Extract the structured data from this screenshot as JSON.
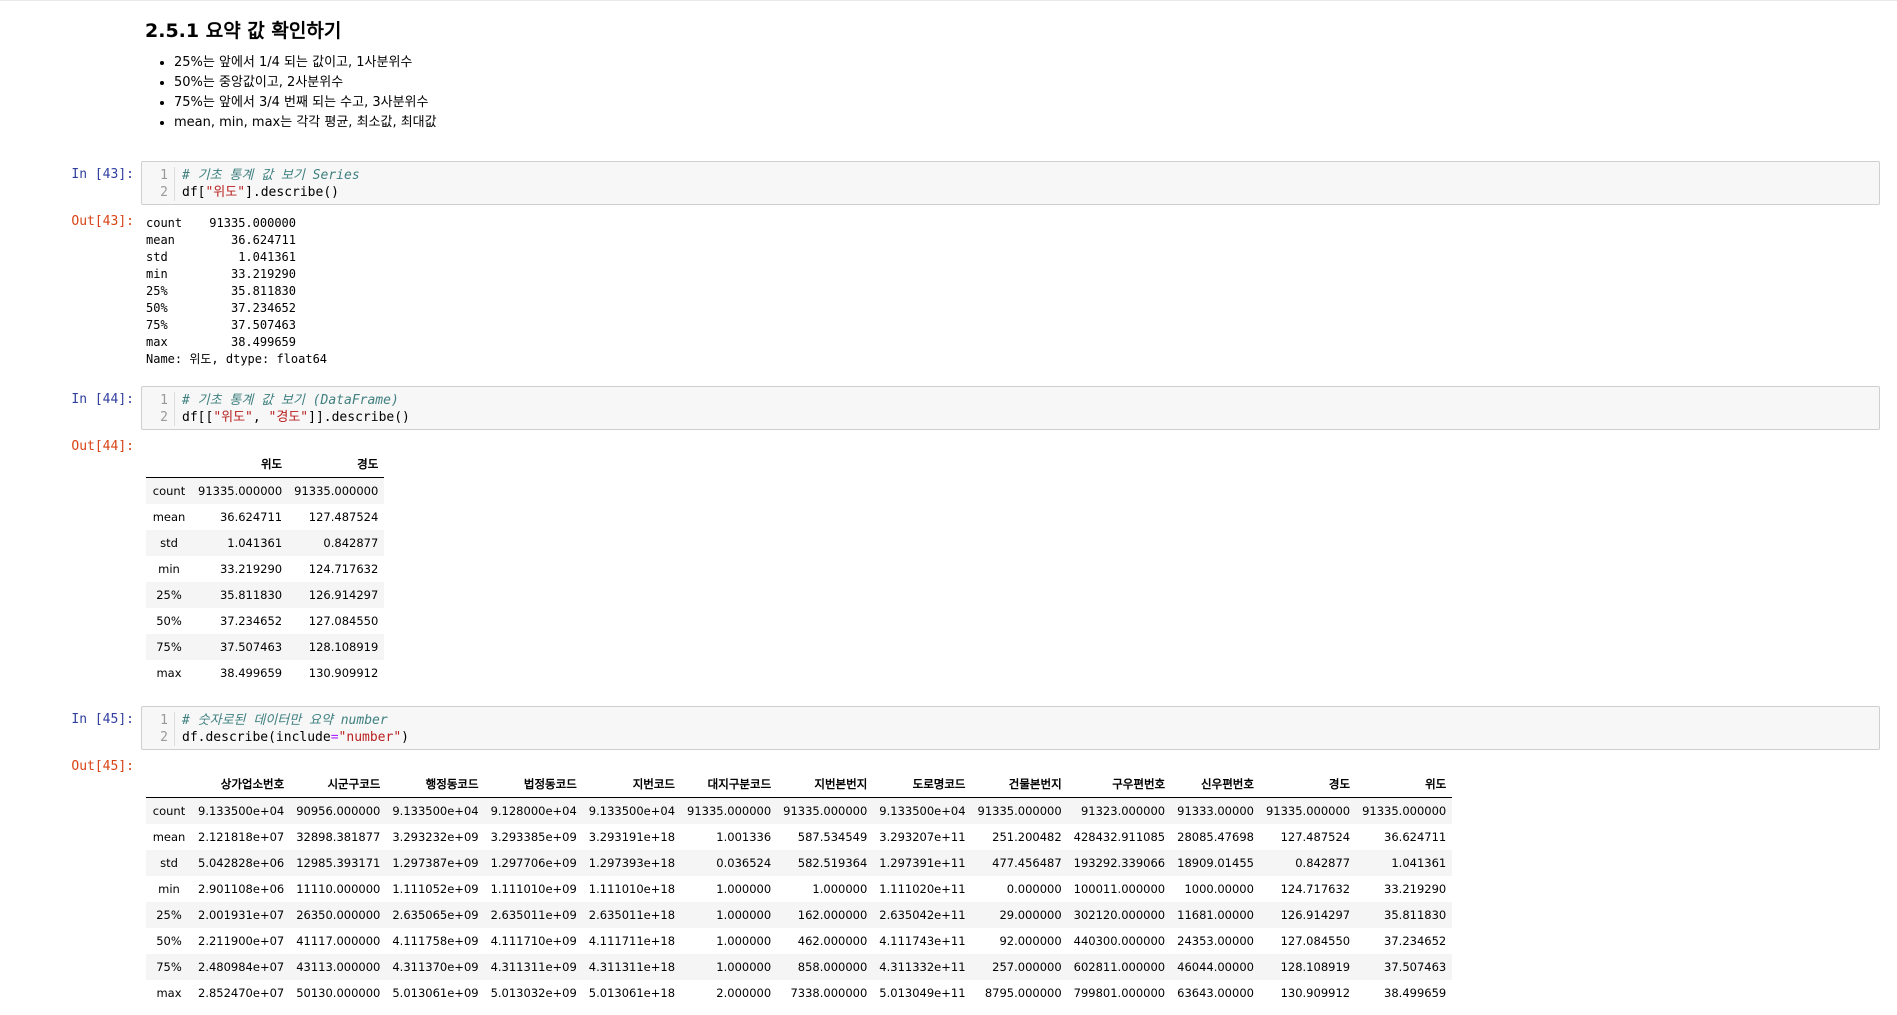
{
  "markdown": {
    "heading": "2.5.1  요약 값 확인하기",
    "bullets": [
      "25%는 앞에서 1/4 되는 값이고, 1사분위수",
      "50%는 중앙값이고, 2사분위수",
      "75%는 앞에서 3/4 번째 되는 수고, 3사분위수",
      "mean, min, max는 각각 평균, 최소값, 최대값"
    ]
  },
  "cell43": {
    "in_prompt": "In [43]:",
    "out_prompt": "Out[43]:",
    "comment": "# 기초 통계 값 보기 Series",
    "code_pre": "df[",
    "code_str": "\"위도\"",
    "code_post": "].describe()",
    "output_rows": [
      {
        "k": "count",
        "v": "91335.000000"
      },
      {
        "k": "mean",
        "v": "36.624711"
      },
      {
        "k": "std",
        "v": "1.041361"
      },
      {
        "k": "min",
        "v": "33.219290"
      },
      {
        "k": "25%",
        "v": "35.811830"
      },
      {
        "k": "50%",
        "v": "37.234652"
      },
      {
        "k": "75%",
        "v": "37.507463"
      },
      {
        "k": "max",
        "v": "38.499659"
      }
    ],
    "output_footer": "Name: 위도, dtype: float64"
  },
  "cell44": {
    "in_prompt": "In [44]:",
    "out_prompt": "Out[44]:",
    "comment": "# 기초 통계 값 보기 (DataFrame)",
    "code_pre": "df[[",
    "code_str1": "\"위도\"",
    "code_sep": ", ",
    "code_str2": "\"경도\"",
    "code_post": "]].describe()",
    "columns": [
      "",
      "위도",
      "경도"
    ],
    "rows": [
      [
        "count",
        "91335.000000",
        "91335.000000"
      ],
      [
        "mean",
        "36.624711",
        "127.487524"
      ],
      [
        "std",
        "1.041361",
        "0.842877"
      ],
      [
        "min",
        "33.219290",
        "124.717632"
      ],
      [
        "25%",
        "35.811830",
        "126.914297"
      ],
      [
        "50%",
        "37.234652",
        "127.084550"
      ],
      [
        "75%",
        "37.507463",
        "128.108919"
      ],
      [
        "max",
        "38.499659",
        "130.909912"
      ]
    ]
  },
  "cell45": {
    "in_prompt": "In [45]:",
    "out_prompt": "Out[45]:",
    "comment": "# 숫자로된 데이터만 요약 number",
    "code_pre": "df.describe(include",
    "code_op": "=",
    "code_str": "\"number\"",
    "code_post": ")",
    "columns": [
      "",
      "상가업소번호",
      "시군구코드",
      "행정동코드",
      "법정동코드",
      "지번코드",
      "대지구분코드",
      "지번본번지",
      "도로명코드",
      "건물본번지",
      "구우편번호",
      "신우편번호",
      "경도",
      "위도"
    ],
    "rows": [
      [
        "count",
        "9.133500e+04",
        "90956.000000",
        "9.133500e+04",
        "9.128000e+04",
        "9.133500e+04",
        "91335.000000",
        "91335.000000",
        "9.133500e+04",
        "91335.000000",
        "91323.000000",
        "91333.00000",
        "91335.000000",
        "91335.000000"
      ],
      [
        "mean",
        "2.121818e+07",
        "32898.381877",
        "3.293232e+09",
        "3.293385e+09",
        "3.293191e+18",
        "1.001336",
        "587.534549",
        "3.293207e+11",
        "251.200482",
        "428432.911085",
        "28085.47698",
        "127.487524",
        "36.624711"
      ],
      [
        "std",
        "5.042828e+06",
        "12985.393171",
        "1.297387e+09",
        "1.297706e+09",
        "1.297393e+18",
        "0.036524",
        "582.519364",
        "1.297391e+11",
        "477.456487",
        "193292.339066",
        "18909.01455",
        "0.842877",
        "1.041361"
      ],
      [
        "min",
        "2.901108e+06",
        "11110.000000",
        "1.111052e+09",
        "1.111010e+09",
        "1.111010e+18",
        "1.000000",
        "1.000000",
        "1.111020e+11",
        "0.000000",
        "100011.000000",
        "1000.00000",
        "124.717632",
        "33.219290"
      ],
      [
        "25%",
        "2.001931e+07",
        "26350.000000",
        "2.635065e+09",
        "2.635011e+09",
        "2.635011e+18",
        "1.000000",
        "162.000000",
        "2.635042e+11",
        "29.000000",
        "302120.000000",
        "11681.00000",
        "126.914297",
        "35.811830"
      ],
      [
        "50%",
        "2.211900e+07",
        "41117.000000",
        "4.111758e+09",
        "4.111710e+09",
        "4.111711e+18",
        "1.000000",
        "462.000000",
        "4.111743e+11",
        "92.000000",
        "440300.000000",
        "24353.00000",
        "127.084550",
        "37.234652"
      ],
      [
        "75%",
        "2.480984e+07",
        "43113.000000",
        "4.311370e+09",
        "4.311311e+09",
        "4.311311e+18",
        "1.000000",
        "858.000000",
        "4.311332e+11",
        "257.000000",
        "602811.000000",
        "46044.00000",
        "128.108919",
        "37.507463"
      ],
      [
        "max",
        "2.852470e+07",
        "50130.000000",
        "5.013061e+09",
        "5.013032e+09",
        "5.013061e+18",
        "2.000000",
        "7338.000000",
        "5.013049e+11",
        "8795.000000",
        "799801.000000",
        "63643.00000",
        "130.909912",
        "38.499659"
      ]
    ]
  }
}
